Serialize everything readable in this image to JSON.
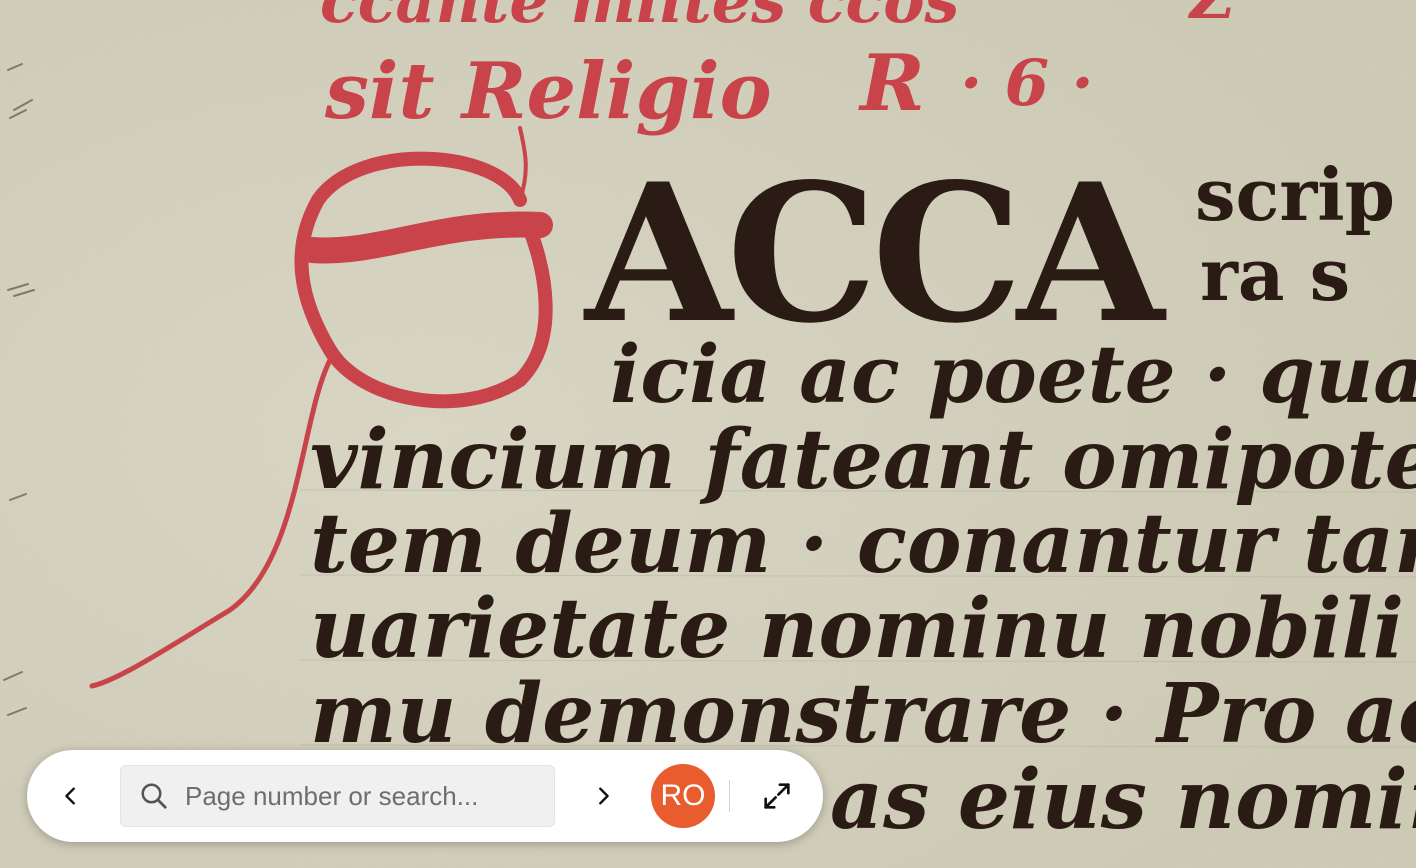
{
  "toolbar": {
    "prev_icon": "chevron-left-icon",
    "next_icon": "chevron-right-icon",
    "search": {
      "placeholder": "Page number or search...",
      "value": "",
      "icon": "search-icon"
    },
    "avatar_initials": "RO",
    "fullscreen_icon": "expand-icon"
  },
  "colors": {
    "parchment": "#d6d3c0",
    "ink": "#2a1c14",
    "rubric_red": "#c8444a",
    "avatar_bg": "#e85c2e",
    "toolbar_bg": "#ffffff"
  }
}
